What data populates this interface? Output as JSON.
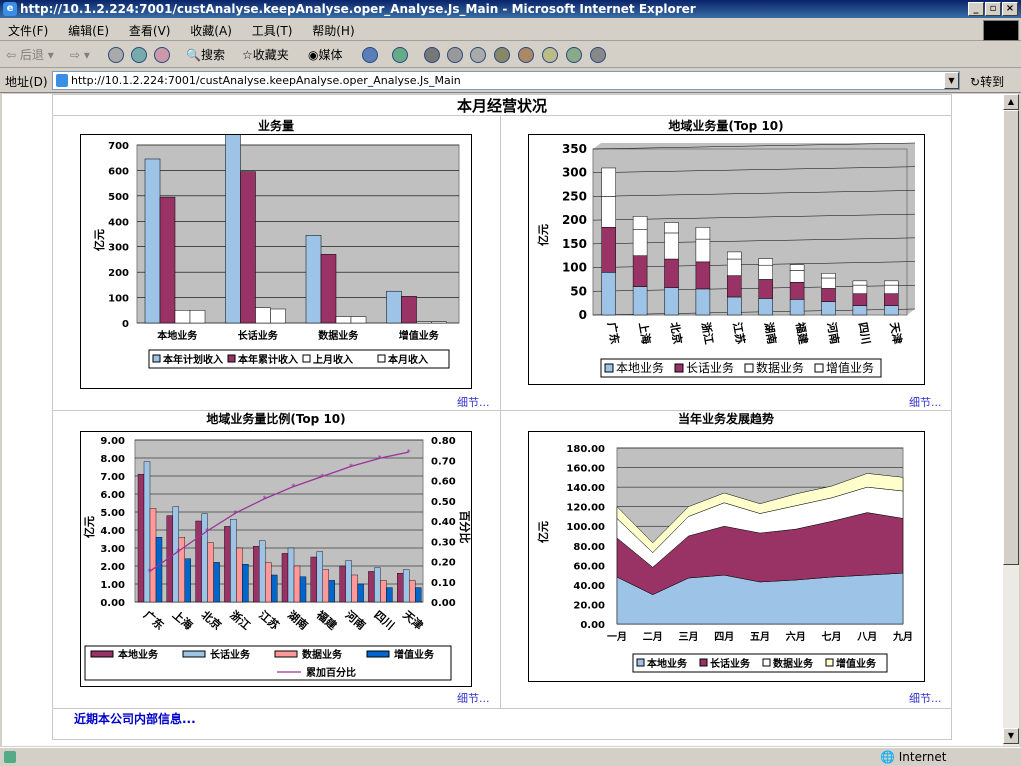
{
  "window": {
    "title": "http://10.1.2.224:7001/custAnalyse.keepAnalyse.oper_Analyse.Js_Main - Microsoft Internet Explorer",
    "icon": "ie-icon",
    "buttons": [
      "minimize",
      "maximize",
      "close"
    ]
  },
  "menu": [
    "文件(F)",
    "编辑(E)",
    "查看(V)",
    "收藏(A)",
    "工具(T)",
    "帮助(H)"
  ],
  "toolbar": {
    "back": "后退",
    "search": "搜索",
    "favorites": "收藏夹",
    "media": "媒体"
  },
  "address": {
    "label": "地址(D)",
    "url": "http://10.1.2.224:7001/custAnalyse.keepAnalyse.oper_Analyse.Js_Main",
    "go": "转到"
  },
  "page": {
    "title": "本月经营状况",
    "more": "细节...",
    "footer_link": "近期本公司内部信息..."
  },
  "status": {
    "zone": "Internet"
  },
  "colors": {
    "blue": "#9dc3e6",
    "purple": "#993366",
    "cream": "#ffffcc",
    "white": "#ffffff",
    "plotbg": "#c0c0c0",
    "darkblue": "#0066cc",
    "salmon": "#ff9999"
  },
  "chart_data": [
    {
      "type": "bar",
      "title": "业务量",
      "ylabel": "亿元",
      "ylim": [
        0,
        700
      ],
      "yticks": [
        0,
        100,
        200,
        300,
        400,
        500,
        600,
        700
      ],
      "categories": [
        "本地业务",
        "长话业务",
        "数据业务",
        "增值业务"
      ],
      "series": [
        {
          "name": "本年计划收入",
          "values": [
            645,
            745,
            345,
            125
          ]
        },
        {
          "name": "本年累计收入",
          "values": [
            495,
            595,
            270,
            105
          ]
        },
        {
          "name": "上月收入",
          "values": [
            50,
            60,
            25,
            5
          ]
        },
        {
          "name": "本月收入",
          "values": [
            50,
            55,
            25,
            5
          ]
        }
      ]
    },
    {
      "type": "bar",
      "stacked": true,
      "title": "地域业务量(Top 10)",
      "ylabel": "亿元",
      "ylim": [
        0,
        350
      ],
      "yticks": [
        0,
        50,
        100,
        150,
        200,
        250,
        300,
        350
      ],
      "categories": [
        "广东",
        "上海",
        "北京",
        "浙江",
        "江苏",
        "湖南",
        "福建",
        "河南",
        "四川",
        "天津"
      ],
      "series": [
        {
          "name": "本地业务",
          "values": [
            90,
            60,
            58,
            55,
            38,
            35,
            33,
            28,
            20,
            20
          ]
        },
        {
          "name": "长话业务",
          "values": [
            95,
            65,
            60,
            57,
            45,
            40,
            36,
            28,
            25,
            25
          ]
        },
        {
          "name": "数据业务",
          "values": [
            65,
            55,
            55,
            48,
            35,
            30,
            25,
            22,
            18,
            18
          ]
        },
        {
          "name": "增值业务",
          "values": [
            60,
            28,
            22,
            25,
            15,
            14,
            12,
            10,
            9,
            9
          ]
        }
      ]
    },
    {
      "type": "bar",
      "title": "地域业务量比例(Top 10)",
      "ylabel": "亿元",
      "y2label": "百分比",
      "ylim": [
        0,
        9
      ],
      "y2lim": [
        0,
        0.8
      ],
      "yticks": [
        "9.00",
        "8.00",
        "7.00",
        "6.00",
        "5.00",
        "4.00",
        "3.00",
        "2.00",
        "1.00",
        "0.00"
      ],
      "y2ticks": [
        "0.80",
        "0.70",
        "0.60",
        "0.50",
        "0.40",
        "0.30",
        "0.20",
        "0.10",
        "0.00"
      ],
      "categories": [
        "广东",
        "上海",
        "北京",
        "浙江",
        "江苏",
        "湖南",
        "福建",
        "河南",
        "四川",
        "天津"
      ],
      "series": [
        {
          "name": "本地业务",
          "values": [
            7.1,
            4.8,
            4.5,
            4.2,
            3.1,
            2.7,
            2.5,
            2.0,
            1.7,
            1.6
          ]
        },
        {
          "name": "长话业务",
          "values": [
            7.8,
            5.3,
            4.9,
            4.6,
            3.4,
            3.0,
            2.8,
            2.3,
            1.9,
            1.8
          ]
        },
        {
          "name": "数据业务",
          "values": [
            5.2,
            3.6,
            3.3,
            3.0,
            2.2,
            2.0,
            1.8,
            1.5,
            1.2,
            1.2
          ]
        },
        {
          "name": "增值业务",
          "values": [
            3.6,
            2.4,
            2.2,
            2.1,
            1.5,
            1.4,
            1.2,
            1.0,
            0.8,
            0.8
          ]
        }
      ],
      "line": {
        "name": "累加百分比",
        "values": [
          0.15,
          0.25,
          0.35,
          0.44,
          0.51,
          0.57,
          0.62,
          0.67,
          0.71,
          0.74
        ]
      }
    },
    {
      "type": "area",
      "stacked": true,
      "title": "当年业务发展趋势",
      "ylabel": "亿元",
      "ylim": [
        0,
        180
      ],
      "yticks": [
        "180.00",
        "160.00",
        "140.00",
        "120.00",
        "100.00",
        "80.00",
        "60.00",
        "40.00",
        "20.00",
        "0.00"
      ],
      "categories": [
        "一月",
        "二月",
        "三月",
        "四月",
        "五月",
        "六月",
        "七月",
        "八月",
        "九月"
      ],
      "series": [
        {
          "name": "本地业务",
          "values": [
            48,
            30,
            47,
            50,
            43,
            45,
            48,
            50,
            52
          ]
        },
        {
          "name": "长话业务",
          "values": [
            40,
            28,
            43,
            50,
            50,
            52,
            57,
            64,
            56
          ]
        },
        {
          "name": "数据业务",
          "values": [
            20,
            15,
            20,
            24,
            20,
            24,
            24,
            26,
            28
          ]
        },
        {
          "name": "增值业务",
          "values": [
            12,
            10,
            10,
            10,
            10,
            12,
            12,
            14,
            14
          ]
        }
      ]
    }
  ]
}
